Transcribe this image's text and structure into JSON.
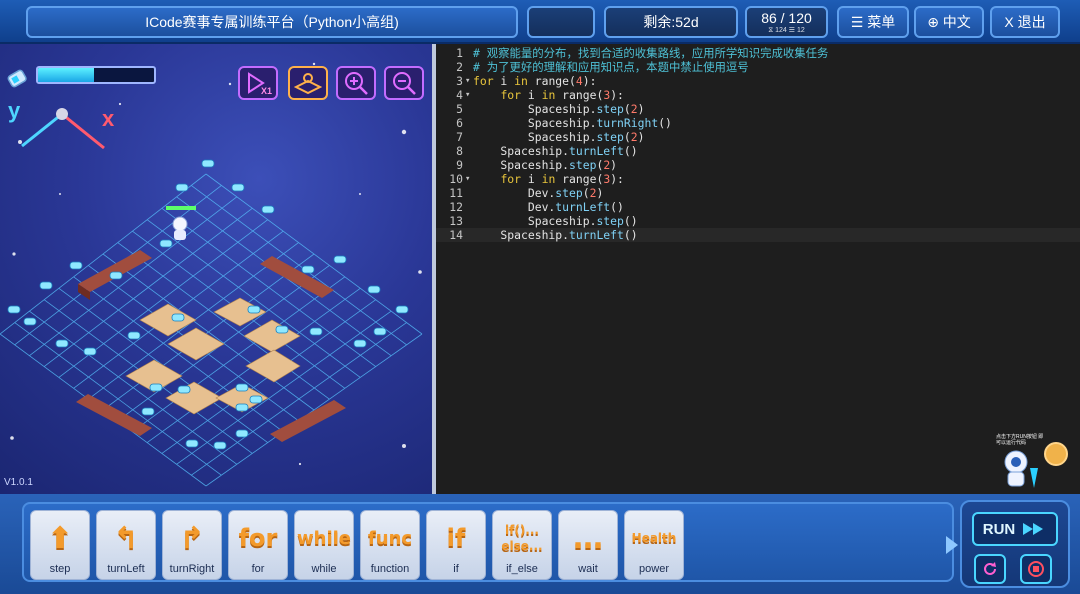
{
  "topbar": {
    "title": "ICode赛事专属训练平台（Python小高组)",
    "blank": "",
    "remaining": "剩余:52d",
    "count_main": "86 / 120",
    "count_sub": "⧖ 124   ☰ 12",
    "menu_label": "☰ 菜单",
    "lang_label": "⊕ 中文",
    "exit_label": "X 退出"
  },
  "game": {
    "energy_level": 0.48,
    "axis_y": "y",
    "axis_x": "x",
    "version": "V1.0.1",
    "buttons": [
      "speed-icon",
      "map-icon",
      "zoom-in-icon",
      "zoom-out-icon"
    ],
    "speed_label": "X1"
  },
  "editor": {
    "lines": [
      {
        "n": "1",
        "fold": "",
        "segments": [
          {
            "c": "c-comment",
            "t": "# 观察能量的分布，找到合适的收集路线，应用所学知识完成收集任务"
          }
        ]
      },
      {
        "n": "2",
        "fold": "",
        "segments": [
          {
            "c": "c-comment",
            "t": "# 为了更好的理解和应用知识点，本题中禁止使用逗号"
          }
        ]
      },
      {
        "n": "3",
        "fold": "▾",
        "segments": [
          {
            "c": "c-kw",
            "t": "for"
          },
          {
            "c": "c-plain",
            "t": " i "
          },
          {
            "c": "c-kw",
            "t": "in"
          },
          {
            "c": "c-plain",
            "t": " range("
          },
          {
            "c": "c-num",
            "t": "4"
          },
          {
            "c": "c-plain",
            "t": "):"
          }
        ]
      },
      {
        "n": "4",
        "fold": "▾",
        "segments": [
          {
            "c": "c-plain",
            "t": "    "
          },
          {
            "c": "c-kw",
            "t": "for"
          },
          {
            "c": "c-plain",
            "t": " i "
          },
          {
            "c": "c-kw",
            "t": "in"
          },
          {
            "c": "c-plain",
            "t": " range("
          },
          {
            "c": "c-num",
            "t": "3"
          },
          {
            "c": "c-plain",
            "t": "):"
          }
        ]
      },
      {
        "n": "5",
        "fold": "",
        "segments": [
          {
            "c": "c-plain",
            "t": "        Spaceship."
          },
          {
            "c": "c-method",
            "t": "step"
          },
          {
            "c": "c-plain",
            "t": "("
          },
          {
            "c": "c-num",
            "t": "2"
          },
          {
            "c": "c-plain",
            "t": ")"
          }
        ]
      },
      {
        "n": "6",
        "fold": "",
        "segments": [
          {
            "c": "c-plain",
            "t": "        Spaceship."
          },
          {
            "c": "c-method",
            "t": "turnRight"
          },
          {
            "c": "c-plain",
            "t": "()"
          }
        ]
      },
      {
        "n": "7",
        "fold": "",
        "segments": [
          {
            "c": "c-plain",
            "t": "        Spaceship."
          },
          {
            "c": "c-method",
            "t": "step"
          },
          {
            "c": "c-plain",
            "t": "("
          },
          {
            "c": "c-num",
            "t": "2"
          },
          {
            "c": "c-plain",
            "t": ")"
          }
        ]
      },
      {
        "n": "8",
        "fold": "",
        "segments": [
          {
            "c": "c-plain",
            "t": "    Spaceship."
          },
          {
            "c": "c-method",
            "t": "turnLeft"
          },
          {
            "c": "c-plain",
            "t": "()"
          }
        ]
      },
      {
        "n": "9",
        "fold": "",
        "segments": [
          {
            "c": "c-plain",
            "t": "    Spaceship."
          },
          {
            "c": "c-method",
            "t": "step"
          },
          {
            "c": "c-plain",
            "t": "("
          },
          {
            "c": "c-num",
            "t": "2"
          },
          {
            "c": "c-plain",
            "t": ")"
          }
        ]
      },
      {
        "n": "10",
        "fold": "▾",
        "segments": [
          {
            "c": "c-plain",
            "t": "    "
          },
          {
            "c": "c-kw",
            "t": "for"
          },
          {
            "c": "c-plain",
            "t": " i "
          },
          {
            "c": "c-kw",
            "t": "in"
          },
          {
            "c": "c-plain",
            "t": " range("
          },
          {
            "c": "c-num",
            "t": "3"
          },
          {
            "c": "c-plain",
            "t": "):"
          }
        ]
      },
      {
        "n": "11",
        "fold": "",
        "segments": [
          {
            "c": "c-plain",
            "t": "        Dev."
          },
          {
            "c": "c-method",
            "t": "step"
          },
          {
            "c": "c-plain",
            "t": "("
          },
          {
            "c": "c-num",
            "t": "2"
          },
          {
            "c": "c-plain",
            "t": ")"
          }
        ]
      },
      {
        "n": "12",
        "fold": "",
        "segments": [
          {
            "c": "c-plain",
            "t": "        Dev."
          },
          {
            "c": "c-method",
            "t": "turnLeft"
          },
          {
            "c": "c-plain",
            "t": "()"
          }
        ]
      },
      {
        "n": "13",
        "fold": "",
        "segments": [
          {
            "c": "c-plain",
            "t": "        Spaceship."
          },
          {
            "c": "c-method",
            "t": "step"
          },
          {
            "c": "c-plain",
            "t": "()"
          }
        ]
      },
      {
        "n": "14",
        "fold": "",
        "active": true,
        "segments": [
          {
            "c": "c-plain",
            "t": "    Spaceship."
          },
          {
            "c": "c-method",
            "t": "turnLeft"
          },
          {
            "c": "c-plain",
            "t": "()"
          }
        ]
      }
    ]
  },
  "robot": {
    "tip": "点击下方RUN按钮 即可以运行代码"
  },
  "toolbar": {
    "tools": [
      {
        "name": "step",
        "label": "step",
        "glyph": "⬆",
        "icon": "step-icon"
      },
      {
        "name": "turnleft",
        "label": "turnLeft",
        "glyph": "↰",
        "icon": "turn-left-icon"
      },
      {
        "name": "turnright",
        "label": "turnRight",
        "glyph": "↱",
        "icon": "turn-right-icon"
      },
      {
        "name": "for",
        "label": "for",
        "glyph": "for",
        "icon": "for-icon"
      },
      {
        "name": "while",
        "label": "while",
        "glyph": "while",
        "icon": "while-icon"
      },
      {
        "name": "function",
        "label": "function",
        "glyph": "func",
        "icon": "func-icon"
      },
      {
        "name": "if",
        "label": "if",
        "glyph": "if",
        "icon": "if-icon"
      },
      {
        "name": "if-else",
        "label": "if_else",
        "glyph": "if()...\nelse...",
        "icon": "if-else-icon"
      },
      {
        "name": "wait",
        "label": "wait",
        "glyph": "…",
        "icon": "wait-icon"
      },
      {
        "name": "power",
        "label": "power",
        "glyph": "Health",
        "icon": "health-icon"
      }
    ],
    "run_label": "RUN"
  }
}
